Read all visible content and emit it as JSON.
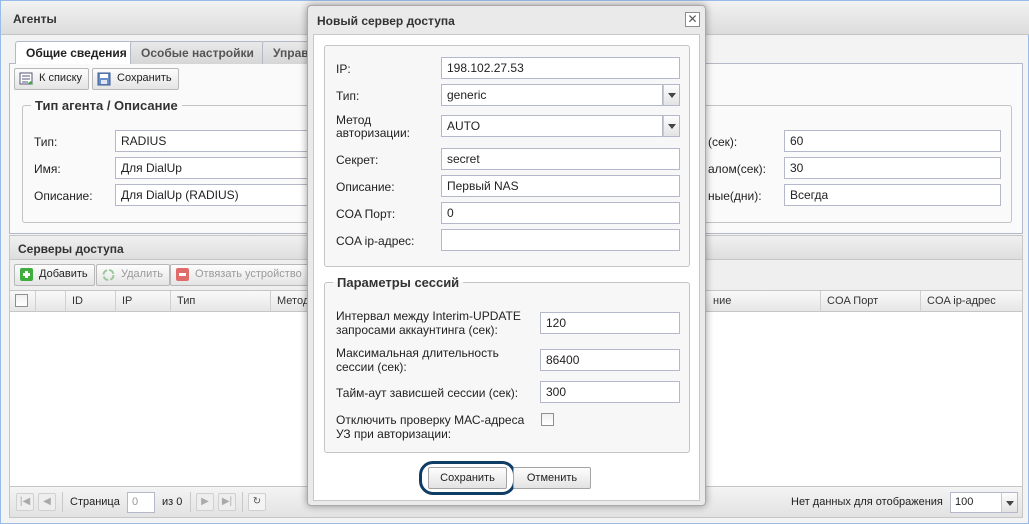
{
  "panel": {
    "title": "Агенты",
    "tabs": [
      {
        "label": "Общие сведения",
        "active": true
      },
      {
        "label": "Особые настройки",
        "active": false
      },
      {
        "label": "Управ",
        "active": false
      }
    ],
    "toolbar": {
      "back_label": "К списку",
      "save_label": "Сохранить"
    },
    "agent_group": {
      "legend": "Тип агента / Описание",
      "type_label": "Тип:",
      "type_value": "RADIUS",
      "name_label": "Имя:",
      "name_value": "Для DialUp",
      "desc_label": "Описание:",
      "desc_value": "Для DialUp (RADIUS)"
    },
    "right_fields": [
      {
        "label": "(сек):",
        "value": "60"
      },
      {
        "label": "алом(сек):",
        "value": "30"
      },
      {
        "label": "ные(дни):",
        "value": "Всегда"
      }
    ]
  },
  "servers": {
    "title": "Серверы доступа",
    "toolbar": {
      "add_label": "Добавить",
      "delete_label": "Удалить",
      "unbind_label": "Отвязать устройство"
    },
    "columns": [
      "ID",
      "IP",
      "Тип",
      "Метод",
      "ние",
      "COA Порт",
      "COA ip-адрес"
    ],
    "paging": {
      "page_label": "Страница",
      "page_value": "0",
      "of_label": "из 0",
      "empty_text": "Нет данных для отображения",
      "page_size": "100"
    }
  },
  "dialog": {
    "title": "Новый сервер доступа",
    "close_glyph": "✕",
    "fields": {
      "ip_label": "IP:",
      "ip_value": "198.102.27.53",
      "type_label": "Тип:",
      "type_value": "generic",
      "auth_label": "Метод авторизации:",
      "auth_value": "AUTO",
      "secret_label": "Секрет:",
      "secret_value": "secret",
      "desc_label": "Описание:",
      "desc_value": "Первый NAS",
      "coa_port_label": "COA Порт:",
      "coa_port_value": "0",
      "coa_ip_label": "COA ip-адрес:",
      "coa_ip_value": ""
    },
    "session": {
      "legend": "Параметры сессий",
      "interim_label": "Интервал между Interim-UPDATE запросами аккаунтинга (сек):",
      "interim_value": "120",
      "max_label": "Максимальная длительность сессии (сек):",
      "max_value": "86400",
      "timeout_label": "Тайм-аут зависшей сессии (сек):",
      "timeout_value": "300",
      "mac_label": "Отключить проверку МАС-адреса УЗ при авторизации:",
      "mac_checked": false
    },
    "buttons": {
      "save_label": "Сохранить",
      "cancel_label": "Отменить"
    }
  },
  "colors": {
    "highlight_ring": "#0e3d66",
    "add_icon": "#3fae3f",
    "unbind_icon": "#e06b6b"
  }
}
